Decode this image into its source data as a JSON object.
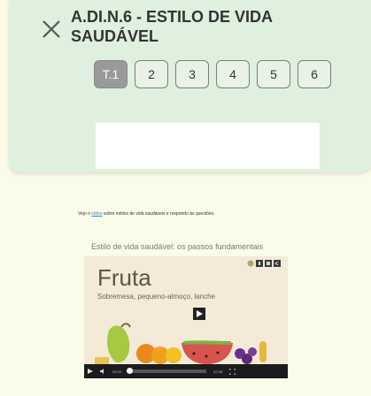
{
  "header": {
    "title": "A.DI.N.6 - ESTILO DE VIDA SAUDÁVEL",
    "tabs": [
      "T.1",
      "2",
      "3",
      "4",
      "5",
      "6"
    ],
    "active_tab": "T.1"
  },
  "content": {
    "instruction_prefix": "Vejo o",
    "instruction_link": "vídeo",
    "instruction_suffix": "sobre estilos de vida saudáveis e respondo às questões.",
    "video_title": "Estilo de vida saudável: os passos fundamentais"
  },
  "video": {
    "heading": "Fruta",
    "subheading": "Sobremesa, pequeno-almoço, lanche",
    "time_current": "00:00",
    "time_total": "02:38",
    "progress": 0
  },
  "icons": {
    "close": "close-icon",
    "play": "play-icon"
  },
  "colors": {
    "header_bg": "#dff0de",
    "page_bg": "#fafbe9",
    "active_tab": "#9a9a9a",
    "link": "#2a8bd6"
  }
}
